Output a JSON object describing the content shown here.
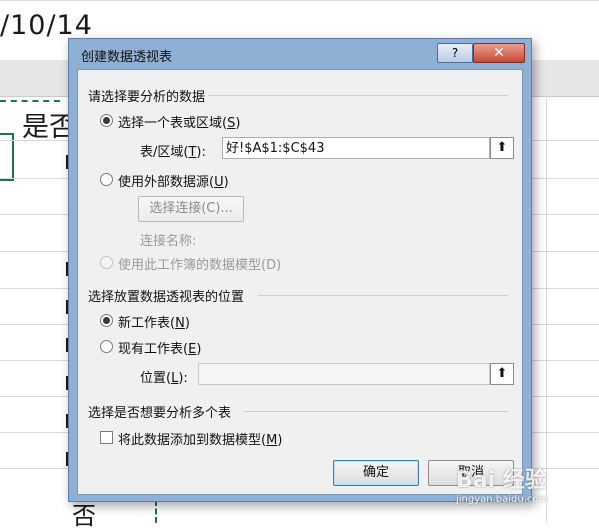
{
  "sheet": {
    "date_text": "/10/14",
    "cell_text": "是否",
    "bottom_text": "否"
  },
  "dialog": {
    "title": "创建数据透视表",
    "help_label": "?",
    "close_label": "✕",
    "section_data": {
      "heading": "请选择要分析的数据",
      "option_table": {
        "label": "选择一个表或区域",
        "hotkey": "S",
        "checked": true
      },
      "range_label": "表/区域",
      "range_hotkey": "T",
      "range_value": "好!$A$1:$C$43",
      "option_external": {
        "label": "使用外部数据源",
        "hotkey": "U",
        "checked": false
      },
      "choose_connection_label": "选择连接(C)...",
      "connection_name_label": "连接名称:",
      "option_model": {
        "label": "使用此工作簿的数据模型(D)",
        "checked": false,
        "disabled": true
      }
    },
    "section_location": {
      "heading": "选择放置数据透视表的位置",
      "option_new": {
        "label": "新工作表",
        "hotkey": "N",
        "checked": true
      },
      "option_existing": {
        "label": "现有工作表",
        "hotkey": "E",
        "checked": false
      },
      "location_label": "位置",
      "location_hotkey": "L",
      "location_value": ""
    },
    "section_multi": {
      "heading": "选择是否想要分析多个表",
      "add_to_model": {
        "label": "将此数据添加到数据模型",
        "hotkey": "M",
        "checked": false
      }
    },
    "ok_label": "确定",
    "cancel_label": "取消"
  },
  "watermark": {
    "text": "Bai 经验",
    "sub": "jingyan.baidu.com"
  }
}
